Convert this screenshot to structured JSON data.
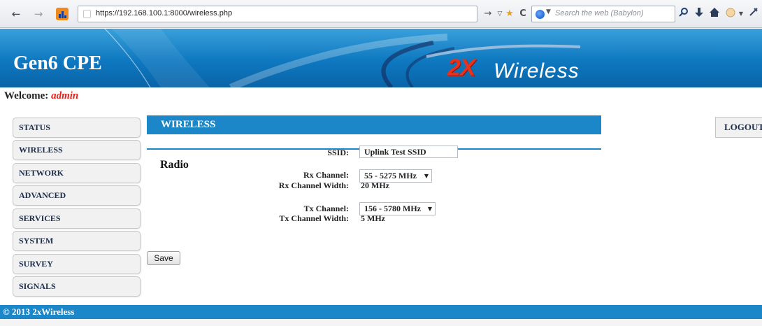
{
  "browser": {
    "url": "https://192.168.100.1:8000/wireless.php",
    "search_placeholder": "Search the web (Babylon)"
  },
  "header": {
    "title": "Gen6 CPE",
    "brand_prefix": "2X",
    "brand_suffix": "Wireless"
  },
  "welcome": {
    "label": "Welcome:",
    "user": "admin"
  },
  "sidebar": {
    "items": [
      {
        "label": "STATUS"
      },
      {
        "label": "WIRELESS"
      },
      {
        "label": "NETWORK"
      },
      {
        "label": "ADVANCED"
      },
      {
        "label": "SERVICES"
      },
      {
        "label": "SYSTEM"
      },
      {
        "label": "SURVEY"
      },
      {
        "label": "SIGNALS"
      }
    ]
  },
  "main": {
    "section_title": "WIRELESS",
    "logout_label": "LOGOUT",
    "radio_heading": "Radio",
    "ssid": {
      "label": "SSID:",
      "value": "Uplink Test SSID"
    },
    "rx_channel": {
      "label": "Rx Channel:",
      "value": "55 - 5275 MHz"
    },
    "rx_width": {
      "label": "Rx Channel Width:",
      "value": "20 MHz"
    },
    "tx_channel": {
      "label": "Tx Channel:",
      "value": "156 - 5780 MHz"
    },
    "tx_width": {
      "label": "Tx Channel Width:",
      "value": "5 MHz"
    },
    "save_label": "Save"
  },
  "footer": {
    "copyright": "© 2013 2xWireless"
  },
  "colors": {
    "header_blue": "#0e78c0",
    "section_blue": "#1b87c8",
    "brand_red": "#e8321e",
    "welcome_user_red": "#e8221a"
  }
}
